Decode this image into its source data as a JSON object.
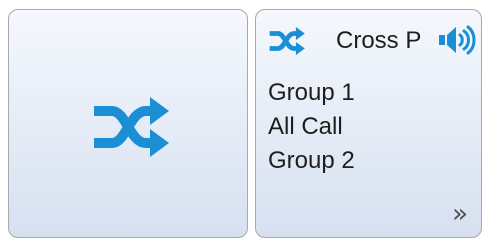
{
  "colors": {
    "accent": "#1a8fd6",
    "tile_border": "#a9a9a9",
    "text": "#1e1e1e"
  },
  "left_tile": {
    "icon": "shuffle-icon"
  },
  "right_tile": {
    "icon": "shuffle-icon",
    "title": "Cross P",
    "audio_icon": "speaker-icon",
    "groups": [
      "Group 1",
      "All Call",
      "Group 2"
    ],
    "more_glyph": "»",
    "more_icon": "double-chevron-right-icon"
  }
}
